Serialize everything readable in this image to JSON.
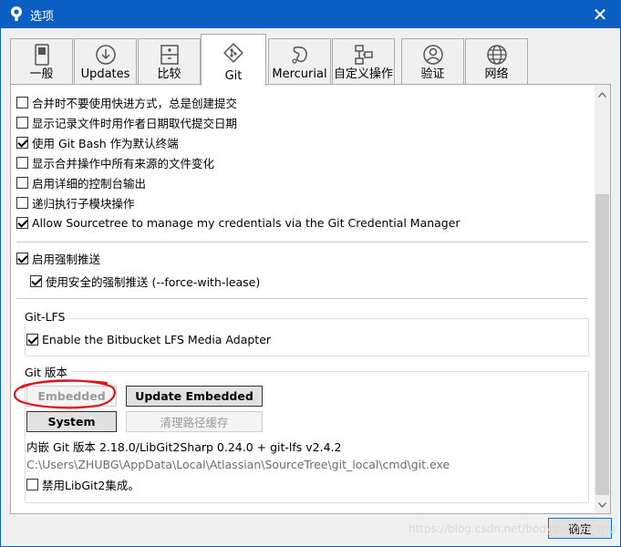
{
  "window": {
    "title": "选项",
    "close_symbol": "✕"
  },
  "tabs": [
    {
      "label": "一般",
      "icon": "switch-icon"
    },
    {
      "label": "Updates",
      "icon": "download-icon"
    },
    {
      "label": "比较",
      "icon": "compare-icon"
    },
    {
      "label": "Git",
      "icon": "git-icon",
      "active": true
    },
    {
      "label": "Mercurial",
      "icon": "mercurial-icon"
    },
    {
      "label": "自定义操作",
      "icon": "custom-actions-icon"
    },
    {
      "label": "验证",
      "icon": "user-icon"
    },
    {
      "label": "网络",
      "icon": "globe-icon"
    }
  ],
  "git_options": [
    {
      "label": "合并时不要使用快进方式，总是创建提交",
      "checked": false
    },
    {
      "label": "显示记录文件时用作者日期取代提交日期",
      "checked": false
    },
    {
      "label": "使用 Git Bash 作为默认终端",
      "checked": true
    },
    {
      "label": "显示合并操作中所有来源的文件变化",
      "checked": false
    },
    {
      "label": "启用详细的控制台输出",
      "checked": false
    },
    {
      "label": "递归执行子模块操作",
      "checked": false
    },
    {
      "label": "Allow Sourcetree to manage my credentials via the Git Credential Manager",
      "checked": true
    }
  ],
  "force_push": {
    "enable": {
      "label": "启用强制推送",
      "checked": true
    },
    "safe": {
      "label": "使用安全的强制推送 (--force-with-lease)",
      "checked": true
    }
  },
  "git_lfs": {
    "title": "Git-LFS",
    "adapter": {
      "label": "Enable the Bitbucket LFS Media Adapter",
      "checked": true
    }
  },
  "git_version": {
    "title": "Git 版本",
    "embedded_label": "Embedded",
    "update_embedded_label": "Update Embedded",
    "system_label": "System",
    "clear_path_cache_label": "清理路径缓存",
    "version_info": "内嵌 Git 版本 2.18.0/LibGit2Sharp 0.24.0 + git-lfs v2.4.2",
    "path": "C:\\Users\\ZHUBG\\AppData\\Local\\Atlassian\\SourceTree\\git_local\\cmd\\git.exe",
    "disable_libgit2": {
      "label": "禁用LibGit2集成。",
      "checked": false
    }
  },
  "scrollbar": {
    "position": 0.75
  },
  "footer": {
    "ok_label": "确定",
    "watermark": "https://blog.csdn.net/bodybuilder_zhu"
  },
  "colors": {
    "titlebar": "#0b5fc3",
    "annotation": "#e0151b"
  }
}
